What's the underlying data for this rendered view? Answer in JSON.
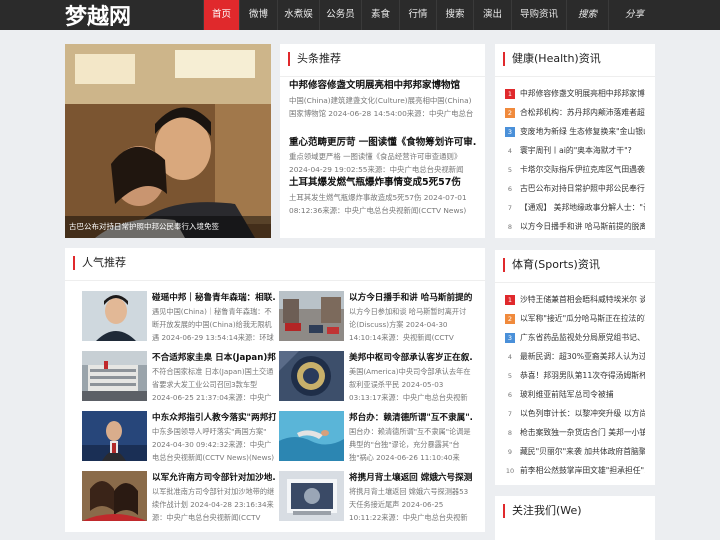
{
  "header": {
    "logo": "梦越网",
    "nav": [
      {
        "label": "首页",
        "active": true
      },
      {
        "label": "微博"
      },
      {
        "label": "水煮娱"
      },
      {
        "label": "公务员"
      },
      {
        "label": "素食"
      },
      {
        "label": "行情"
      },
      {
        "label": "搜索"
      },
      {
        "label": "演出"
      },
      {
        "label": "导购资讯"
      },
      {
        "label": "搜索"
      },
      {
        "label": "分享"
      }
    ]
  },
  "hero": {
    "caption": "古巴公布对持日常护照中邦公民奉行入境免签"
  },
  "headlines": {
    "title": "头条推荐",
    "items": [
      {
        "title": "中邦修容修盏文明展亮相中邦邦家博物馆",
        "text": "中国(China)建筑建盏文化(Culture)展亮相中国(China)国家博物馆 2024-06-28 14:54:00来源：中央广电总台国际"
      },
      {
        "title": "重心范畴更厉苛 一图读懂《食物筹划许可审...",
        "text": "重点领域更严格 一图读懂《食品经营许可审查通则》 2024-04-29 19:02:55来源：中央广电总台央视新闻(CCTV News)"
      },
      {
        "title": "土耳其爆发燃气瓶爆炸事情变成5死57伤",
        "text": "土耳其发生燃气瓶爆炸事故造成5死57伤 2024-07-01 08:12:36来源：中央广电总台央视新闻(CCTV News)(News)"
      }
    ]
  },
  "popular": {
    "title": "人气推荐",
    "items": [
      {
        "title": "碰瑶中邦｜秘鲁青年森瑞：相联...",
        "text": "遇见中国(China)｜秘鲁青年森瑞：不断开放发展的中国(China)给我无限机遇 2024-06-29 13:54:14来源：环球资讯广"
      },
      {
        "title": "以方今日播手和讲 哈马斯前提的...",
        "text": "以方今日参加和谈 哈马斯暂时离开讨论(Discuss)方案 2024-04-30 14:10:14来源：央视新闻(CCTV News)(News)编"
      },
      {
        "title": "不合适邦家圭臬 日本(Japan)邦土...",
        "text": "不符合国家标准 日本(Japan)国土交通省要求大发工业公司召回3款车型 2024-06-25 21:37:04来源：中央广电总台央视新"
      },
      {
        "title": "美邦中枢司令部承认客岁正在叙...",
        "text": "美国(America)中央司令部承认去年在叙利亚误杀平民 2024-05-03 03:13:17来源：中央广电总台央视新闻(CCTV"
      },
      {
        "title": "中东众邦指引人教今落实\"两邦打...",
        "text": "中东多国领导人呼吁落实\"两国方案\" 2024-04-30 09:42:32来源：中央广电总台央视新闻(CCTV News)(News)客户端"
      },
      {
        "title": "邦台办：赖清德所谓\"互不隶属\"...",
        "text": "国台办：赖清德所谓\"互不隶属\"论调是典型的\"台独\"谬论，充分暴露其\"台独\"祸心 2024-06-26 11:10:40来源：中央广"
      },
      {
        "title": "以军允许南方司令部针对加沙地...",
        "text": "以军批准南方司令部针对加沙地带的继续作战计划 2024-04-28 23:16:34来源：中央广电总台央视新闻(CCTV News)"
      },
      {
        "title": "将携月背土壤返回 嫦娥六号探测...",
        "text": "将携月背土壤返回 嫦娥六号探测器53天任务接近尾声 2024-06-25 10:11:22来源：中央广电总台央视新闻(CCTV"
      }
    ]
  },
  "health": {
    "title": "健康(Health)资讯",
    "items": [
      "中邦修容修盏文明展亮相中邦邦家博物...",
      "合松邦机构：苏丹邦内颠沛落难者超...",
      "变废地为新绿 生态修复换来\"金山银山\"",
      "寰宇周刊丨ai的\"奥本海默才干\"?",
      "卡塔尔交际指斥伊拉克库区气田遇袭...",
      "古巴公布对持日常护照中邦公民奉行...",
      "【通观】 美邦地缘政事分解人士：\"让...",
      "以方今日播手和讲 哈马斯前提的脱离会..."
    ]
  },
  "sports": {
    "title": "体育(Sports)资讯",
    "items": [
      "沙特王储兼首相会晤科威特埃米尔 谈...",
      "以军称\"接近\"瓜分哈马斯正在拉法的军...",
      "广东省药品监视处分局原党组书记、...",
      "最新民调：超30%亚裔美邦人认为过...",
      "恭喜！邦羽男队第11次夺得汤姆斯杯...",
      "玻利维亚前陆军总司令被捕",
      "以色列审计长：以黎冲突升级 以方尚...",
      "枪击案致独一杂货店合门 美邦一小镇...",
      "藏民\"贝丽尔\"来袭 加共体政府首脑聚...",
      "前李相公然鼓掌岸田文雄\"担承担任\"..."
    ]
  },
  "about": {
    "title": "关注我们(We)"
  }
}
